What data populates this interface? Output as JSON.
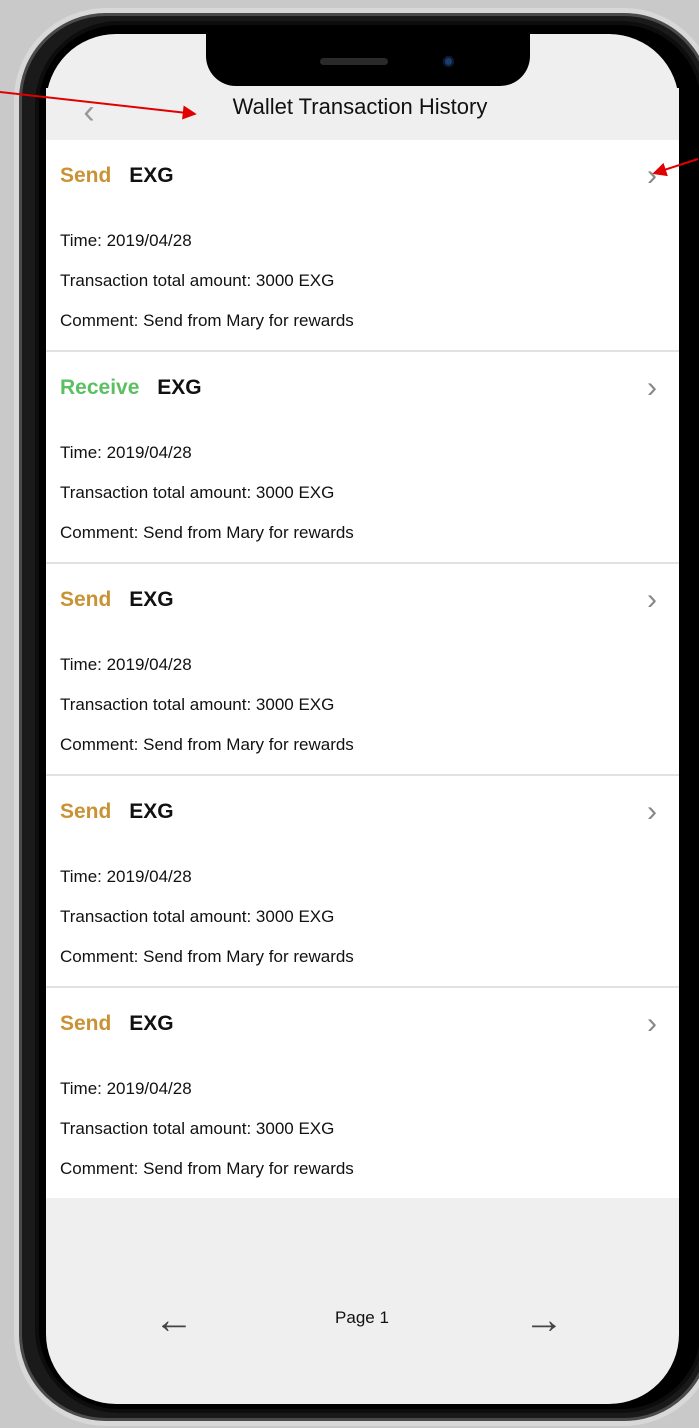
{
  "header": {
    "back_icon": "chevron-left-icon",
    "title": "Wallet Transaction History"
  },
  "transactions": [
    {
      "type": "Send",
      "coin": "EXG",
      "time": "Time:  2019/04/28",
      "amount": "Transaction total amount:  3000 EXG",
      "comment": "Comment:  Send from Mary for rewards"
    },
    {
      "type": "Receive",
      "coin": "EXG",
      "time": "Time:  2019/04/28",
      "amount": "Transaction total amount:  3000 EXG",
      "comment": "Comment:  Send from Mary for rewards"
    },
    {
      "type": "Send",
      "coin": "EXG",
      "time": "Time:  2019/04/28",
      "amount": "Transaction total amount:  3000 EXG",
      "comment": "Comment:  Send from Mary for rewards"
    },
    {
      "type": "Send",
      "coin": "EXG",
      "time": "Time:  2019/04/28",
      "amount": "Transaction total amount:  3000 EXG",
      "comment": "Comment:  Send from Mary for rewards"
    },
    {
      "type": "Send",
      "coin": "EXG",
      "time": "Time:  2019/04/28",
      "amount": "Transaction total amount:  3000 EXG",
      "comment": "Comment:  Send from Mary for rewards"
    }
  ],
  "pagination": {
    "label": "Page 1",
    "prev_icon": "arrow-left-icon",
    "next_icon": "arrow-right-icon"
  },
  "colors": {
    "send": "#c99335",
    "receive": "#5cc063",
    "annotation": "#e00000"
  }
}
